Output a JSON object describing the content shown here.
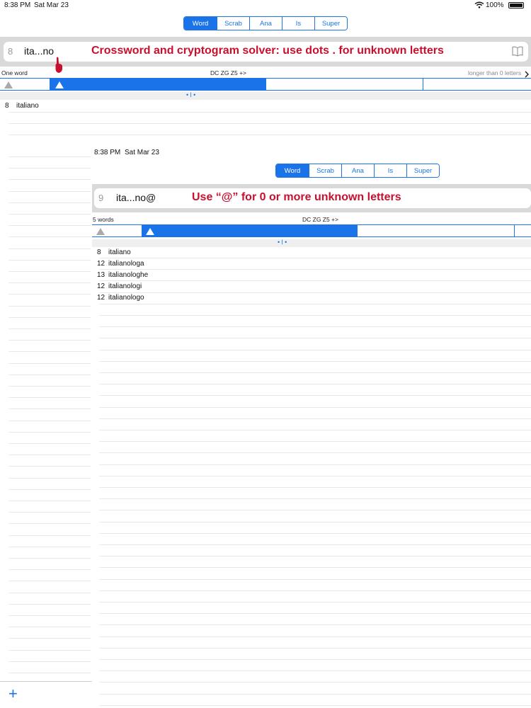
{
  "outer": {
    "status_time": "8:38 PM",
    "status_date": "Sat Mar 23",
    "battery": "100%",
    "tabs": [
      "Word",
      "Scrab",
      "Ana",
      "Is",
      "Super"
    ],
    "selected_tab": "Word",
    "search": {
      "count": "8",
      "query": "ita...no"
    },
    "annotation": "Crossword and cryptogram solver: use dots . for unknown letters",
    "result_summary": "One word",
    "dictionary_label": "DC ZG Z5 +>",
    "length_filter": "longer than 0 letters",
    "results": [
      {
        "len": "8",
        "word": "italiano"
      }
    ],
    "add_label": "+"
  },
  "inner": {
    "status_time": "8:38 PM",
    "status_date": "Sat Mar 23",
    "tabs": [
      "Word",
      "Scrab",
      "Ana",
      "Is",
      "Super"
    ],
    "selected_tab": "Word",
    "search": {
      "count": "9",
      "query": "ita...no@"
    },
    "annotation": "Use “@” for 0 or more unknown letters",
    "result_summary": "5 words",
    "dictionary_label": "DC ZG Z5 +>",
    "results": [
      {
        "len": "8",
        "word": "italiano"
      },
      {
        "len": "12",
        "word": "italianologa"
      },
      {
        "len": "13",
        "word": "italianologhe"
      },
      {
        "len": "12",
        "word": "italianologi"
      },
      {
        "len": "12",
        "word": "italianologo"
      }
    ]
  },
  "pager_dots": "• l •",
  "colors": {
    "accent": "#1a73e8",
    "annotation": "#c8102e"
  }
}
